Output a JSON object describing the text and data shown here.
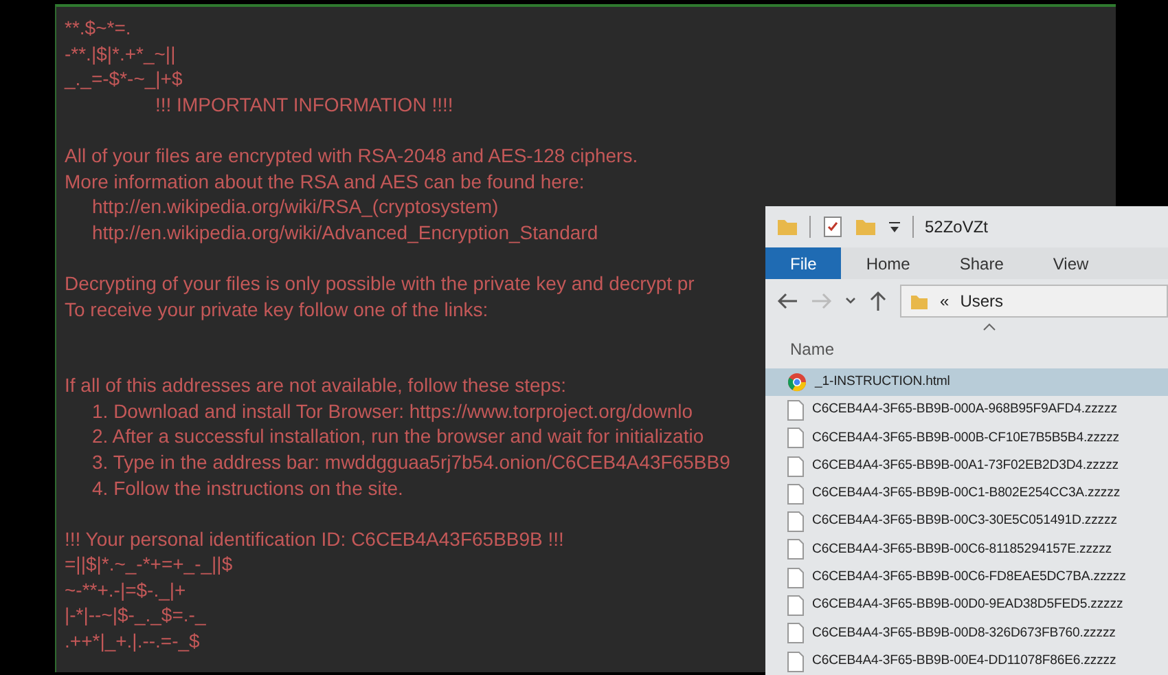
{
  "note": {
    "paragraphs": [
      {
        "lines": [
          {
            "text": "**.$~*=.",
            "kind": "plain"
          },
          {
            "text": "-**.|$|*.+*_~||",
            "kind": "plain"
          },
          {
            "text": "_._=-$*-~_|+$",
            "kind": "plain"
          },
          {
            "text": "!!! IMPORTANT INFORMATION !!!!",
            "kind": "heading"
          }
        ]
      },
      {
        "lines": [
          {
            "text": "All of your files are encrypted with RSA-2048 and AES-128 ciphers.",
            "kind": "plain"
          },
          {
            "text": "More information about the RSA and AES can be found here:",
            "kind": "plain"
          },
          {
            "text": "http://en.wikipedia.org/wiki/RSA_(cryptosystem)",
            "kind": "indented"
          },
          {
            "text": "http://en.wikipedia.org/wiki/Advanced_Encryption_Standard",
            "kind": "indented"
          }
        ]
      },
      {
        "lines": [
          {
            "text": "Decrypting of your files is only possible with the private key and decrypt pr",
            "kind": "plain"
          },
          {
            "text": "To receive your private key follow one of the links:",
            "kind": "plain"
          }
        ]
      },
      {
        "lines": [
          {
            "text": "If all of this addresses are not available, follow these steps:",
            "kind": "plain"
          },
          {
            "text": "1. Download and install Tor Browser: https://www.torproject.org/downlo",
            "kind": "indented"
          },
          {
            "text": "2. After a successful installation, run the browser and wait for initializatio",
            "kind": "indented"
          },
          {
            "text": "3. Type in the address bar: mwddgguaa5rj7b54.onion/C6CEB4A43F65BB9",
            "kind": "indented"
          },
          {
            "text": "4. Follow the instructions on the site.",
            "kind": "indented"
          }
        ]
      },
      {
        "lines": [
          {
            "text": "!!! Your personal identification ID: C6CEB4A43F65BB9B !!!",
            "kind": "plain"
          },
          {
            "text": "=||$|*.~_-*+=+_-_||$",
            "kind": "plain"
          },
          {
            "text": "~-**+.-|=$-._|+",
            "kind": "plain"
          },
          {
            "text": "|-*|--~|$-_._$=.-_",
            "kind": "plain"
          },
          {
            "text": ".++*|_+.|.--.=-_$",
            "kind": "plain"
          }
        ]
      }
    ]
  },
  "explorer": {
    "title": "52ZoVZt",
    "tabs": [
      {
        "label": "File",
        "selected": true
      },
      {
        "label": "Home",
        "selected": false
      },
      {
        "label": "Share",
        "selected": false
      },
      {
        "label": "View",
        "selected": false
      }
    ],
    "address": {
      "separator": "«",
      "path": "Users"
    },
    "column": "Name",
    "files": [
      {
        "name": "_1-INSTRUCTION.html",
        "kind": "web",
        "selected": true
      },
      {
        "name": "C6CEB4A4-3F65-BB9B-000A-968B95F9AFD4.zzzzz",
        "kind": "file",
        "selected": false
      },
      {
        "name": "C6CEB4A4-3F65-BB9B-000B-CF10E7B5B5B4.zzzzz",
        "kind": "file",
        "selected": false
      },
      {
        "name": "C6CEB4A4-3F65-BB9B-00A1-73F02EB2D3D4.zzzzz",
        "kind": "file",
        "selected": false
      },
      {
        "name": "C6CEB4A4-3F65-BB9B-00C1-B802E254CC3A.zzzzz",
        "kind": "file",
        "selected": false
      },
      {
        "name": "C6CEB4A4-3F65-BB9B-00C3-30E5C051491D.zzzzz",
        "kind": "file",
        "selected": false
      },
      {
        "name": "C6CEB4A4-3F65-BB9B-00C6-81185294157E.zzzzz",
        "kind": "file",
        "selected": false
      },
      {
        "name": "C6CEB4A4-3F65-BB9B-00C6-FD8EAE5DC7BA.zzzzz",
        "kind": "file",
        "selected": false
      },
      {
        "name": "C6CEB4A4-3F65-BB9B-00D0-9EAD38D5FED5.zzzzz",
        "kind": "file",
        "selected": false
      },
      {
        "name": "C6CEB4A4-3F65-BB9B-00D8-326D673FB760.zzzzz",
        "kind": "file",
        "selected": false
      },
      {
        "name": "C6CEB4A4-3F65-BB9B-00E4-DD11078F86E6.zzzzz",
        "kind": "file",
        "selected": false
      }
    ]
  }
}
